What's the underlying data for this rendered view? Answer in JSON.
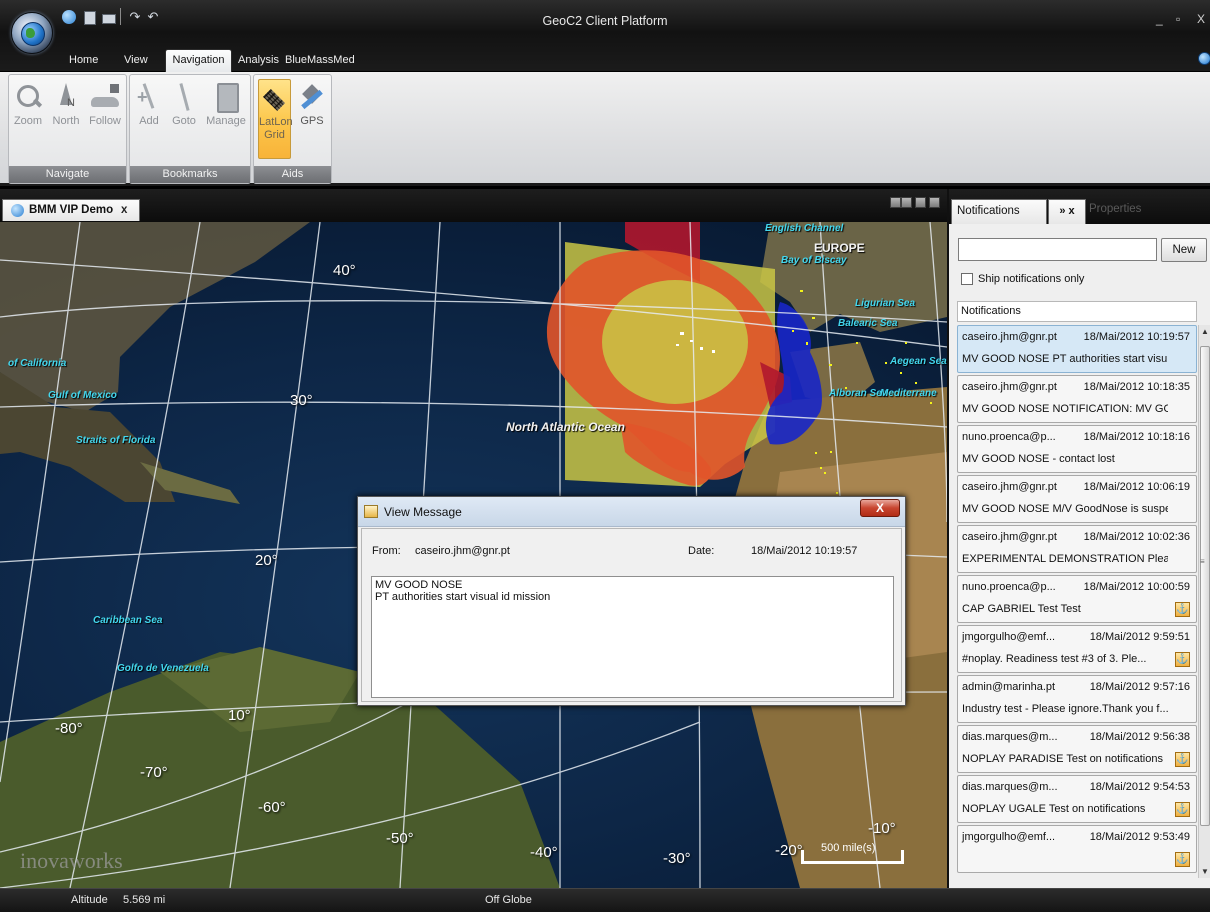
{
  "app": {
    "title": "GeoC2 Client Platform",
    "ribbon_tabs": [
      {
        "label": "Home"
      },
      {
        "label": "View"
      },
      {
        "label": "Navigation"
      },
      {
        "label": "Analysis"
      },
      {
        "label": "BlueMassMed"
      }
    ],
    "active_tab": "Navigation"
  },
  "ribbon": {
    "navigate": {
      "label": "Navigate",
      "buttons": [
        "Zoom",
        "North",
        "Follow"
      ]
    },
    "bookmarks": {
      "label": "Bookmarks",
      "buttons": [
        "Add",
        "Goto",
        "Manage"
      ]
    },
    "aids": {
      "label": "Aids",
      "latlon_line1": "LatLon",
      "latlon_line2": "Grid",
      "gps": "GPS"
    }
  },
  "document": {
    "tab_label": "BMM VIP Demo",
    "tab_close": "x"
  },
  "map": {
    "latitudes": [
      "40°",
      "30°",
      "20°",
      "10°"
    ],
    "longitudes": [
      "-80°",
      "-70°",
      "-60°",
      "-50°",
      "-40°",
      "-30°",
      "-20°",
      "-10°"
    ],
    "labels": {
      "europe": "EUROPE",
      "north_atlantic": "North Atlantic Ocean",
      "of_california": "of California",
      "gulf_of_mexico": "Gulf of Mexico",
      "straits_of_florida": "Straits of Florida",
      "caribbean_sea": "Caribbean Sea",
      "golfo_venezuela": "Golfo de Venezuela",
      "bay_of_biscay": "Bay of Biscay",
      "english_channel": "English Channel",
      "ligurian_sea": "Ligurian Sea",
      "balearic_sea": "Balearic Sea",
      "alboran_sea": "Alboran Sea",
      "mediterranean": "Mediterrane",
      "aegean_sea": "Aegean Sea"
    },
    "scale_label": "500 mile(s)",
    "watermark": "inovaworks"
  },
  "dialog": {
    "title": "View Message",
    "close_label": "X",
    "from_label": "From:",
    "from_value": "caseiro.jhm@gnr.pt",
    "date_label": "Date:",
    "date_value": "18/Mai/2012 10:19:57",
    "message": "MV GOOD NOSE\nPT authorities start visual id mission"
  },
  "panel": {
    "tabs": {
      "notifications": "Notifications",
      "controls": "» x",
      "properties": "Properties"
    },
    "search_value": "",
    "new_button": "New",
    "ship_only_label": "Ship notifications only",
    "ship_only_checked": false,
    "list_header": "Notifications",
    "notifications": [
      {
        "sender": "caseiro.jhm@gnr.pt",
        "date": "18/Mai/2012 10:19:57",
        "subject": "MV GOOD NOSE PT authorities start visu...",
        "ship": false,
        "selected": true
      },
      {
        "sender": "caseiro.jhm@gnr.pt",
        "date": "18/Mai/2012 10:18:35",
        "subject": "MV GOOD NOSE NOTIFICATION: MV GO...",
        "ship": false,
        "selected": false
      },
      {
        "sender": "nuno.proenca@p...",
        "date": "18/Mai/2012 10:18:16",
        "subject": "MV GOOD NOSE - contact lost",
        "ship": false,
        "selected": false
      },
      {
        "sender": "caseiro.jhm@gnr.pt",
        "date": "18/Mai/2012 10:06:19",
        "subject": "MV GOOD NOSE M/V GoodNose is suspec...",
        "ship": false,
        "selected": false
      },
      {
        "sender": "caseiro.jhm@gnr.pt",
        "date": "18/Mai/2012 10:02:36",
        "subject": "EXPERIMENTAL DEMONSTRATION Please...",
        "ship": false,
        "selected": false
      },
      {
        "sender": "nuno.proenca@p...",
        "date": "18/Mai/2012 10:00:59",
        "subject": "CAP GABRIEL Test Test",
        "ship": true,
        "selected": false
      },
      {
        "sender": "jmgorgulho@emf...",
        "date": "18/Mai/2012 9:59:51",
        "subject": "#noplay. Readiness test #3 of 3. Ple...",
        "ship": true,
        "selected": false
      },
      {
        "sender": "admin@marinha.pt",
        "date": "18/Mai/2012 9:57:16",
        "subject": "Industry test - Please ignore.Thank you f...",
        "ship": false,
        "selected": false
      },
      {
        "sender": "dias.marques@m...",
        "date": "18/Mai/2012 9:56:38",
        "subject": "NOPLAY PARADISE Test on notifications",
        "ship": true,
        "selected": false
      },
      {
        "sender": "dias.marques@m...",
        "date": "18/Mai/2012 9:54:53",
        "subject": "NOPLAY UGALE Test on notifications",
        "ship": true,
        "selected": false
      },
      {
        "sender": "jmgorgulho@emf...",
        "date": "18/Mai/2012 9:53:49",
        "subject": "",
        "ship": true,
        "selected": false
      }
    ]
  },
  "status": {
    "altitude_label": "Altitude",
    "altitude_value": "5.569 mi",
    "off_globe": "Off Globe"
  },
  "icons": {
    "app_orb": "globe-icon",
    "ship": "anchor-icon",
    "dialog": "java-cup-icon"
  },
  "colors": {
    "zone_yellow": "#c9c545",
    "zone_orange": "#e1542a",
    "zone_red": "#b0172d",
    "zone_blue": "#1726c8",
    "selected_row": "#d6e8f6",
    "active_button": "#fcc64a"
  }
}
